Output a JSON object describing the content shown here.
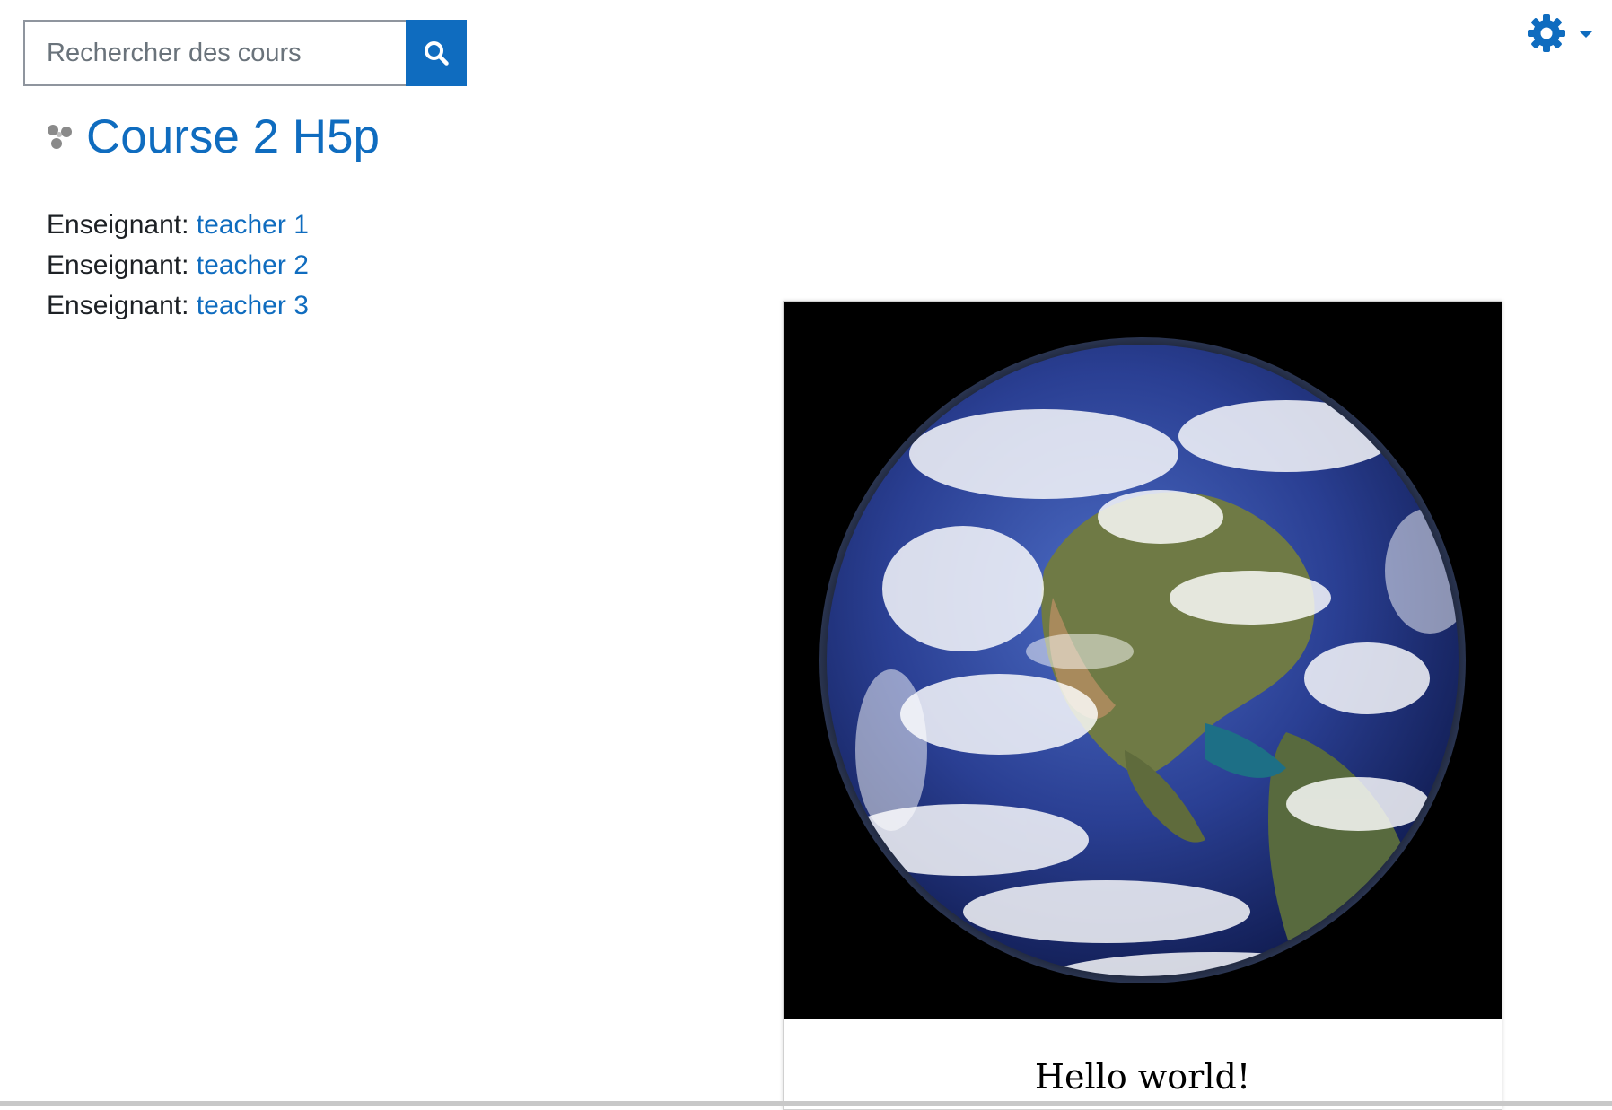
{
  "search": {
    "placeholder": "Rechercher des cours",
    "icon": "search-icon"
  },
  "settings_menu": {
    "icon": "gear-icon",
    "caret_icon": "caret-down-icon"
  },
  "course": {
    "title": "Course 2 H5p",
    "icon": "course-category-icon"
  },
  "teachers": [
    {
      "role": "Enseignant:",
      "name": "teacher 1"
    },
    {
      "role": "Enseignant:",
      "name": "teacher 2"
    },
    {
      "role": "Enseignant:",
      "name": "teacher 3"
    }
  ],
  "h5p": {
    "image": "earth-image",
    "caption": "Hello world!"
  },
  "colors": {
    "accent": "#0f6cbf",
    "text": "#1d2125"
  }
}
